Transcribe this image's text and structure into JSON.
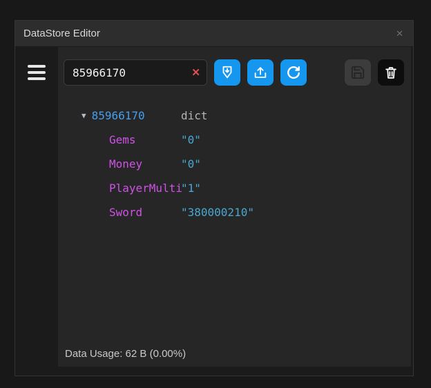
{
  "window": {
    "title": "DataStore Editor",
    "close_glyph": "✕"
  },
  "toolbar": {
    "search_value": "85966170",
    "clear_glyph": "✕",
    "buttons": [
      "download-pin",
      "upload",
      "refresh",
      "save",
      "delete"
    ]
  },
  "tree": {
    "expander_glyph": "▼",
    "root": {
      "name": "85966170",
      "type": "dict"
    },
    "children": [
      {
        "key": "Gems",
        "value": "\"0\""
      },
      {
        "key": "Money",
        "value": "\"0\""
      },
      {
        "key": "PlayerMulti",
        "value": "\"1\""
      },
      {
        "key": "Sword",
        "value": "\"380000210\""
      }
    ]
  },
  "status": {
    "data_usage": "Data Usage: 62 B (0.00%)"
  },
  "colors": {
    "accent": "#1596ef",
    "tree_root": "#459fec",
    "key": "#cf52e6",
    "value": "#4aa8d0",
    "danger": "#e05252"
  }
}
